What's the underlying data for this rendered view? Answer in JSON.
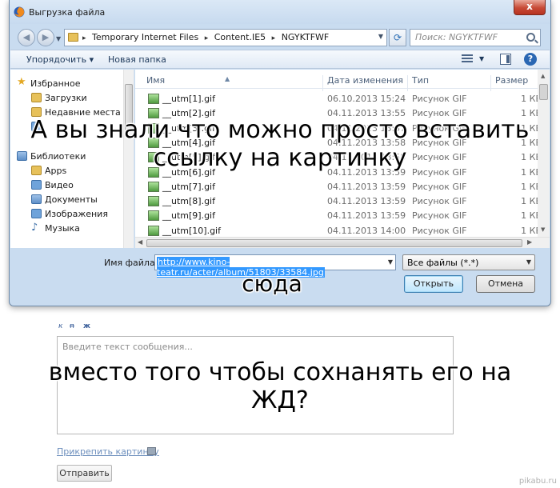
{
  "window": {
    "title": "Выгрузка файла",
    "close_label": "x"
  },
  "address": {
    "crumbs": [
      "Temporary Internet Files",
      "Content.IE5",
      "NGYKTFWF"
    ],
    "separator": "▸"
  },
  "search": {
    "placeholder": "Поиск: NGYKTFWF"
  },
  "toolbar": {
    "organize_label": "Упорядочить ▾",
    "new_folder_label": "Новая папка",
    "help_label": "?"
  },
  "nav": {
    "favorites": "Избранное",
    "downloads": "Загрузки",
    "recent": "Недавние места",
    "libraries": "Библиотеки",
    "apps": "Apps",
    "video": "Видео",
    "documents": "Документы",
    "images": "Изображения",
    "music": "Музыка"
  },
  "columns": {
    "name": "Имя",
    "date": "Дата изменения",
    "type": "Тип",
    "size": "Размер"
  },
  "files": [
    {
      "name": "__utm[1].gif",
      "date": "06.10.2013 15:24",
      "type": "Рисунок GIF",
      "size": "1 КБ"
    },
    {
      "name": "__utm[2].gif",
      "date": "04.11.2013 13:55",
      "type": "Рисунок GIF",
      "size": "1 КБ"
    },
    {
      "name": "__utm[3].gif",
      "date": "04.11.2013 13:57",
      "type": "Рисунок GIF",
      "size": "1 КБ"
    },
    {
      "name": "__utm[4].gif",
      "date": "04.11.2013 13:58",
      "type": "Рисунок GIF",
      "size": "1 КБ"
    },
    {
      "name": "__utm[5].gif",
      "date": "04.11.2013 13:58",
      "type": "Рисунок GIF",
      "size": "1 КБ"
    },
    {
      "name": "__utm[6].gif",
      "date": "04.11.2013 13:59",
      "type": "Рисунок GIF",
      "size": "1 КБ"
    },
    {
      "name": "__utm[7].gif",
      "date": "04.11.2013 13:59",
      "type": "Рисунок GIF",
      "size": "1 КБ"
    },
    {
      "name": "__utm[8].gif",
      "date": "04.11.2013 13:59",
      "type": "Рисунок GIF",
      "size": "1 КБ"
    },
    {
      "name": "__utm[9].gif",
      "date": "04.11.2013 13:59",
      "type": "Рисунок GIF",
      "size": "1 КБ"
    },
    {
      "name": "__utm[10].gif",
      "date": "04.11.2013 14:00",
      "type": "Рисунок GIF",
      "size": "1 КБ"
    }
  ],
  "footer": {
    "filename_label": "Имя файла:",
    "filename_value": "http://www.kino-teatr.ru/acter/album/51803/33584.jpg",
    "filter_value": "Все файлы (*.*)",
    "open_label": "Открыть",
    "cancel_label": "Отмена"
  },
  "page": {
    "format_italic": "к",
    "format_strike": "п",
    "format_bold": "ж",
    "message_placeholder": "Введите текст сообщения...",
    "attach_label": "Прикрепить картинку",
    "send_label": "Отправить",
    "watermark": "pikabu.ru"
  },
  "caption": {
    "line1": "А вы знали что можно просто вставить",
    "line2": "ссылку на картинку",
    "line3": "сюда",
    "line4": "вместо того чтобы сохнанять его на",
    "line5": "ЖД?"
  }
}
